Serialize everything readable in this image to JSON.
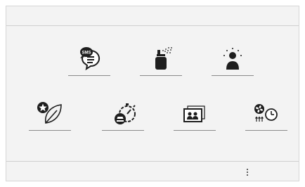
{
  "tiles": [
    {
      "icon": "sms-message-icon",
      "label": "SMS"
    },
    {
      "icon": "fragrance-spray-icon"
    },
    {
      "icon": "ambient-light-person-icon"
    },
    {
      "icon": "eco-leaf-star-icon"
    },
    {
      "icon": "vehicle-timer-icon"
    },
    {
      "icon": "photo-frame-icon"
    },
    {
      "icon": "preconditioning-timer-icon"
    }
  ],
  "menu": {
    "icon": "kebab-menu-icon"
  },
  "colors": {
    "icon": "#1e1e1e",
    "underline": "#8a8a8a",
    "background": "#f3f3f3",
    "divider": "#cfcfcf"
  }
}
